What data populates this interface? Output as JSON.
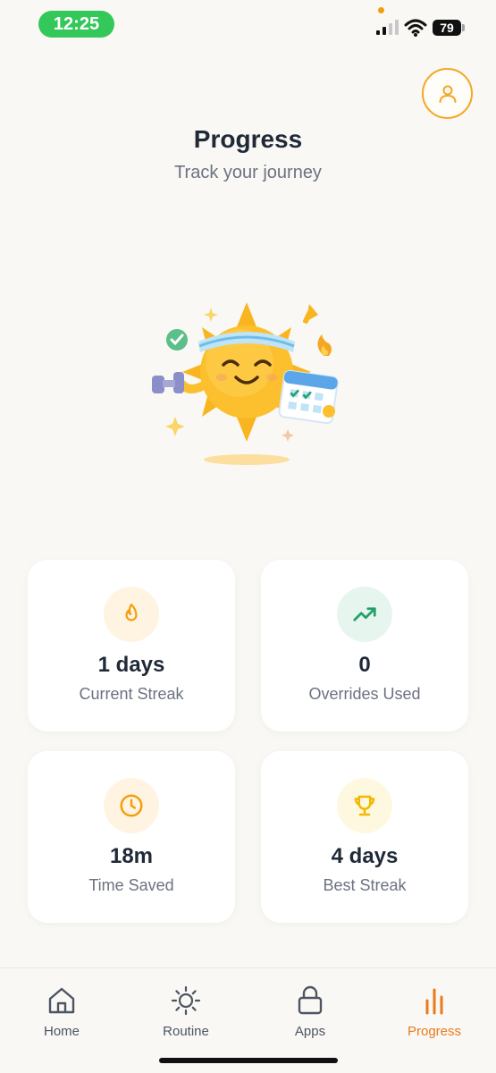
{
  "status_bar": {
    "time": "12:25",
    "battery": "79"
  },
  "header": {
    "title": "Progress",
    "subtitle": "Track your journey"
  },
  "stats": [
    {
      "value": "1 days",
      "label": "Current Streak",
      "icon": "flame-icon",
      "icon_color": "#f59e0b",
      "bg_color": "#fff4e2"
    },
    {
      "value": "0",
      "label": "Overrides Used",
      "icon": "trending-up-icon",
      "icon_color": "#22a06b",
      "bg_color": "#e6f6ef"
    },
    {
      "value": "18m",
      "label": "Time Saved",
      "icon": "clock-icon",
      "icon_color": "#f59e0b",
      "bg_color": "#fff4e2"
    },
    {
      "value": "4 days",
      "label": "Best Streak",
      "icon": "trophy-icon",
      "icon_color": "#f5b700",
      "bg_color": "#fff8e1"
    }
  ],
  "tabs": [
    {
      "label": "Home",
      "icon": "home-icon",
      "active": false
    },
    {
      "label": "Routine",
      "icon": "sun-icon",
      "active": false
    },
    {
      "label": "Apps",
      "icon": "lock-icon",
      "active": false
    },
    {
      "label": "Progress",
      "icon": "bar-chart-icon",
      "active": true
    }
  ],
  "colors": {
    "accent": "#ea7a1a",
    "background": "#faf8f4",
    "status_green": "#34c759"
  }
}
